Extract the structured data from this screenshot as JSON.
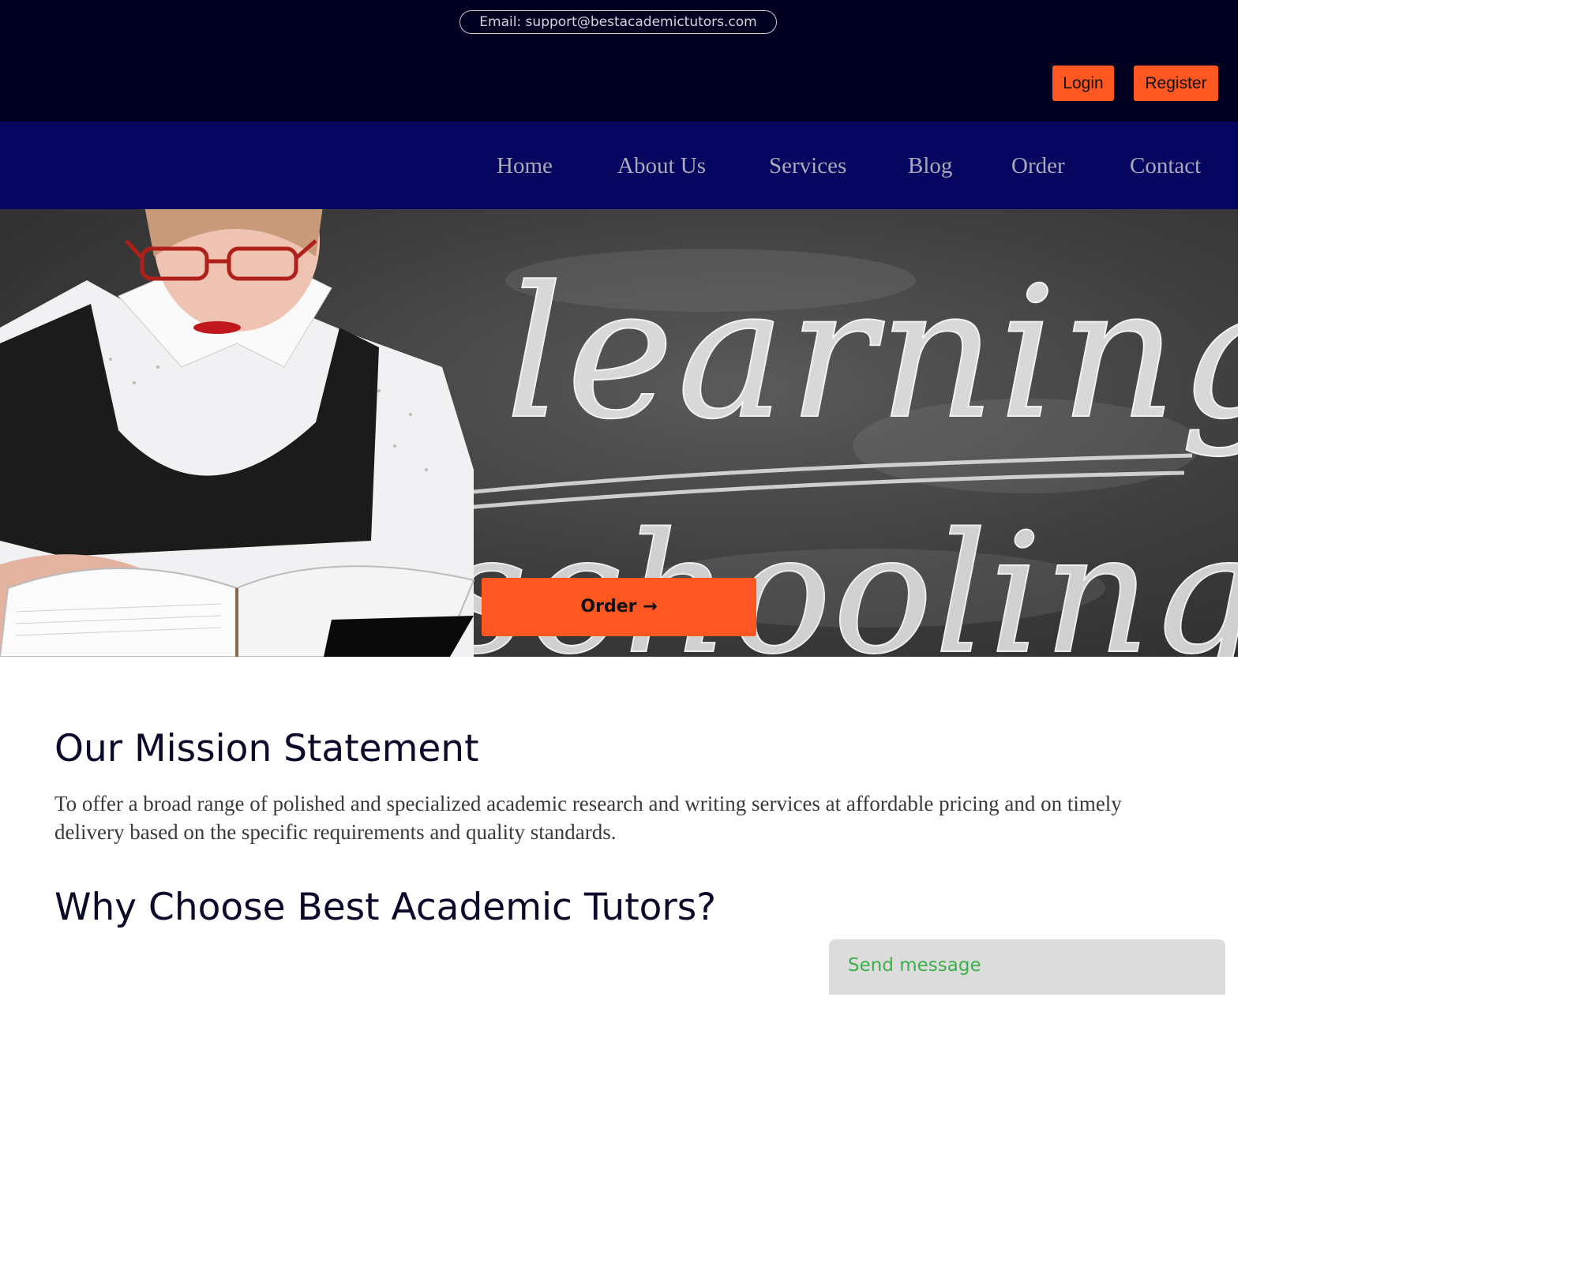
{
  "header": {
    "email": "Email: support@bestacademictutors.com",
    "login_label": "Login",
    "register_label": "Register"
  },
  "nav": {
    "items": [
      "Home",
      "About Us",
      "Services",
      "Blog",
      "Order",
      "Contact"
    ]
  },
  "hero": {
    "chalk_word_1": "learning",
    "chalk_word_2": "schooling",
    "order_label": "Order →"
  },
  "mission": {
    "title": "Our Mission Statement",
    "text": "To offer a broad range of polished and specialized academic research and writing services at affordable pricing and on timely delivery based on the specific requirements and quality standards."
  },
  "why": {
    "title": "Why Choose Best Academic Tutors?"
  },
  "chat": {
    "label": "Send message"
  },
  "colors": {
    "topbar": "#000020",
    "navbar": "#060660",
    "accent": "#ff5722",
    "chat_text": "#3cb04a"
  }
}
